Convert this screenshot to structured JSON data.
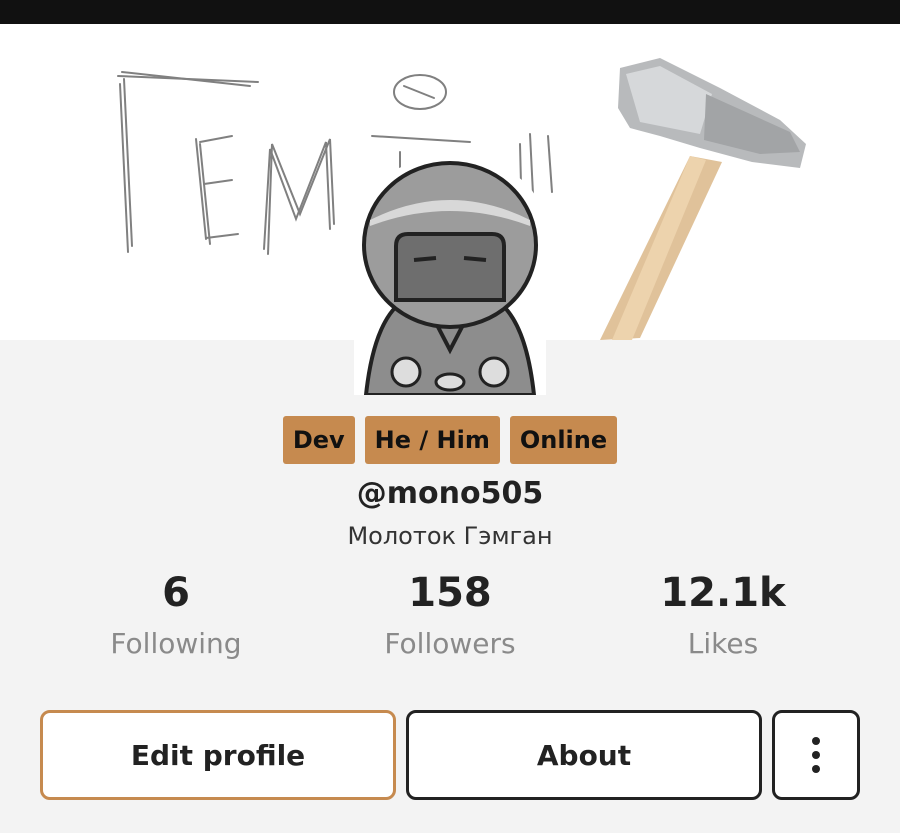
{
  "profile": {
    "tags": [
      "Dev",
      "He / Him",
      "Online"
    ],
    "handle": "@mono505",
    "display_name": "Молоток Гэмган"
  },
  "stats": {
    "following": {
      "value": "6",
      "label": "Following"
    },
    "followers": {
      "value": "158",
      "label": "Followers"
    },
    "likes": {
      "value": "12.1k",
      "label": "Likes"
    }
  },
  "actions": {
    "edit_label": "Edit profile",
    "about_label": "About",
    "more_icon": "more-vertical-icon"
  },
  "colors": {
    "accent": "#c68a4f",
    "status_bar": "#111111",
    "background": "#f3f3f3"
  }
}
